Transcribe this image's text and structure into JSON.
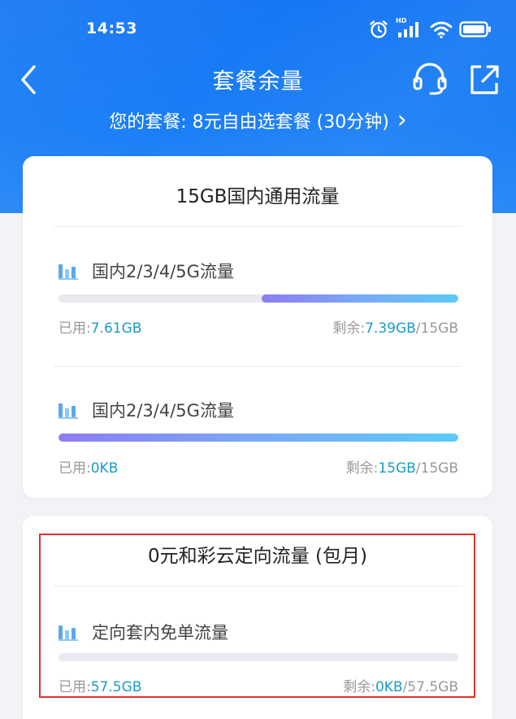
{
  "status_bar": {
    "time": "14:53",
    "icons": [
      "alarm-icon",
      "hd-signal-icon",
      "wifi-icon",
      "battery-icon"
    ],
    "hd_label": "HD"
  },
  "navbar": {
    "title": "套餐余量",
    "back_icon": "chevron-left-icon",
    "headset_icon": "headset-icon",
    "share_icon": "share-icon"
  },
  "plan": {
    "text": "您的套餐: 8元自由选套餐 (30分钟)",
    "arrow": "›"
  },
  "colors": {
    "header_blue": "#1677f4",
    "accent_value": "#1a9bc7",
    "highlight_border": "#e0302a",
    "bar_gradient_start": "#8c7cf3",
    "bar_gradient_end": "#5ccaf7"
  },
  "cards": [
    {
      "title": "15GB国内通用流量",
      "items": [
        {
          "label": "国内2/3/4/5G流量",
          "used_prefix": "已用:",
          "used_value": "7.61GB",
          "remain_prefix": "剩余:",
          "remain_value": "7.39GB",
          "total": "/15GB",
          "remaining_fraction": 0.4927
        },
        {
          "label": "国内2/3/4/5G流量",
          "used_prefix": "已用:",
          "used_value": "0KB",
          "remain_prefix": "剩余:",
          "remain_value": "15GB",
          "total": "/15GB",
          "remaining_fraction": 1.0
        }
      ]
    },
    {
      "title": "0元和彩云定向流量 (包月)",
      "items": [
        {
          "label": "定向套内免单流量",
          "used_prefix": "已用:",
          "used_value": "57.5GB",
          "remain_prefix": "剩余:",
          "remain_value": "0KB",
          "total": "/57.5GB",
          "remaining_fraction": 0.0
        }
      ]
    }
  ]
}
